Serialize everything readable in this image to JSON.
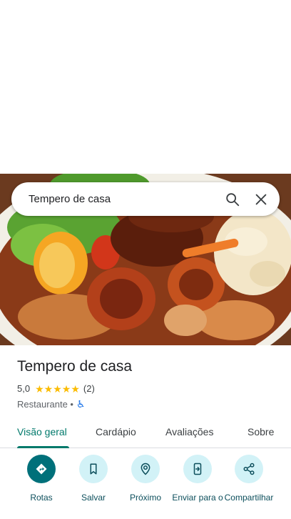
{
  "search": {
    "query": "Tempero de casa"
  },
  "place": {
    "name": "Tempero de casa",
    "rating": "5,0",
    "stars": 5,
    "review_count": "(2)",
    "category": "Restaurante •"
  },
  "tabs": [
    {
      "label": "Visão geral",
      "active": true
    },
    {
      "label": "Cardápio",
      "active": false
    },
    {
      "label": "Avaliações",
      "active": false
    },
    {
      "label": "Sobre",
      "active": false
    }
  ],
  "actions": [
    {
      "label": "Rotas",
      "icon": "directions-icon"
    },
    {
      "label": "Salvar",
      "icon": "bookmark-icon"
    },
    {
      "label": "Próximo",
      "icon": "nearby-icon"
    },
    {
      "label": "Enviar para o",
      "icon": "send-to-phone-icon"
    },
    {
      "label": "Compartilhar",
      "icon": "share-icon"
    }
  ],
  "colors": {
    "accent": "#00796b",
    "action_primary": "#00707a",
    "action_bg": "#d2f2f7",
    "star": "#fbbc04"
  }
}
